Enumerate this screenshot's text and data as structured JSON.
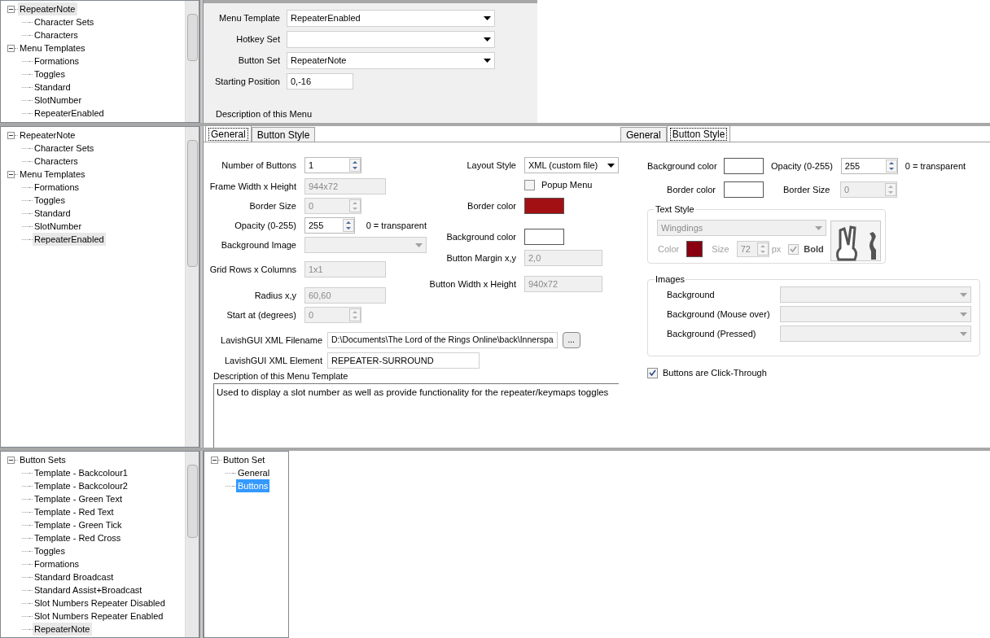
{
  "top_tree": {
    "focused": false,
    "nodes": [
      {
        "label": "RepeaterNote",
        "selected": true,
        "expanded": true,
        "children": [
          {
            "label": "Character Sets",
            "selected": false
          },
          {
            "label": "Characters",
            "selected": false
          }
        ]
      },
      {
        "label": "Menu Templates",
        "selected": false,
        "expanded": true,
        "children": [
          {
            "label": "Formations",
            "selected": false
          },
          {
            "label": "Toggles",
            "selected": false
          },
          {
            "label": "Standard",
            "selected": false
          },
          {
            "label": "SlotNumber",
            "selected": false
          },
          {
            "label": "RepeaterEnabled",
            "selected": false
          }
        ]
      }
    ]
  },
  "menu_form": {
    "fields": [
      {
        "label": "Menu Template",
        "value": "RepeaterEnabled",
        "kind": "dropdown"
      },
      {
        "label": "Hotkey Set",
        "kind": "dropdown"
      },
      {
        "label": "Button Set",
        "value": "RepeaterNote",
        "kind": "dropdown"
      },
      {
        "label": "Starting Position",
        "value": "0,-16",
        "kind": "text"
      }
    ],
    "description_label": "Description of this Menu"
  },
  "template_tree": {
    "focused": false,
    "nodes": [
      {
        "label": "RepeaterNote",
        "selected": false,
        "expanded": true,
        "children": [
          {
            "label": "Character Sets",
            "selected": false
          },
          {
            "label": "Characters",
            "selected": false
          }
        ]
      },
      {
        "label": "Menu Templates",
        "selected": false,
        "expanded": true,
        "children": [
          {
            "label": "Formations",
            "selected": false
          },
          {
            "label": "Toggles",
            "selected": false
          },
          {
            "label": "Standard",
            "selected": false
          },
          {
            "label": "SlotNumber",
            "selected": false
          },
          {
            "label": "RepeaterEnabled",
            "selected": true
          }
        ]
      }
    ]
  },
  "general_panel": {
    "tabs": [
      {
        "label": "General",
        "selected": true
      },
      {
        "label": "Button Style",
        "selected": false
      }
    ],
    "left_fields": [
      {
        "label": "Number of Buttons",
        "value": "1",
        "kind": "spin",
        "disabled": false
      },
      {
        "label": "Frame Width x Height",
        "value": "944x72",
        "kind": "text",
        "disabled": true
      },
      {
        "label": "Border Size",
        "value": "0",
        "kind": "spin",
        "disabled": true
      },
      {
        "label": "Opacity (0-255)",
        "value": "255",
        "kind": "spin",
        "disabled": false,
        "note": "0 = transparent"
      },
      {
        "label": "Background Image",
        "kind": "dropdown",
        "disabled": true
      },
      {
        "label": "Grid Rows x Columns",
        "value": "1x1",
        "kind": "text",
        "disabled": true
      },
      {
        "label": "Radius x,y",
        "value": "60,60",
        "kind": "text",
        "disabled": true
      },
      {
        "label": "Start at (degrees)",
        "value": "0",
        "kind": "spin",
        "disabled": true
      }
    ],
    "right_fields": [
      {
        "label": "Layout Style",
        "value": "XML (custom file)",
        "kind": "dropdown",
        "disabled": false
      },
      {
        "label": "Popup Menu",
        "kind": "checkbox",
        "checked": false
      },
      {
        "label": "Border color",
        "kind": "color",
        "color": "#a31014"
      },
      {
        "label": "Background color",
        "kind": "color",
        "color": "#ffffff"
      },
      {
        "label": "Button Margin x,y",
        "value": "2,0",
        "kind": "text",
        "disabled": true
      },
      {
        "label": "Button Width x Height",
        "value": "940x72",
        "kind": "text",
        "disabled": true
      }
    ],
    "xml_filename": {
      "label": "LavishGUI XML Filename",
      "value": "D:\\Documents\\The Lord of the Rings Online\\back\\Innerspa",
      "button": "..."
    },
    "xml_element": {
      "label": "LavishGUI XML Element",
      "value": "REPEATER-SURROUND"
    },
    "description": {
      "label": "Description of this Menu Template",
      "value": "Used to display a slot number as well as provide functionality for the repeater/keymaps toggles"
    }
  },
  "style_panel": {
    "tabs": [
      {
        "label": "General",
        "selected": false
      },
      {
        "label": "Button Style",
        "selected": true
      }
    ],
    "background_color": {
      "label": "Background color",
      "color": "#ffffff"
    },
    "opacity": {
      "label": "Opacity (0-255)",
      "value": "255",
      "note": "0 = transparent"
    },
    "border_color": {
      "label": "Border color",
      "color": "#ffffff"
    },
    "border_size": {
      "label": "Border Size",
      "value": "0"
    },
    "text_style": {
      "title": "Text Style",
      "font": "Wingdings",
      "color_label": "Color",
      "color": "#8b0010",
      "size_label": "Size",
      "size": "72",
      "unit": "px",
      "bold_label": "Bold",
      "bold": true
    },
    "images": {
      "title": "Images",
      "rows": [
        {
          "label": "Background"
        },
        {
          "label": "Background (Mouse over)"
        },
        {
          "label": "Background (Pressed)"
        }
      ]
    },
    "click_through": {
      "label": "Buttons are Click-Through",
      "checked": true
    }
  },
  "sets_tree": {
    "focused": false,
    "nodes": [
      {
        "label": "Button Sets",
        "selected": false,
        "expanded": true,
        "children": [
          {
            "label": "Template - Backcolour1",
            "selected": false
          },
          {
            "label": "Template - Backcolour2",
            "selected": false
          },
          {
            "label": "Template - Green Text",
            "selected": false
          },
          {
            "label": "Template - Red Text",
            "selected": false
          },
          {
            "label": "Template - Green Tick",
            "selected": false
          },
          {
            "label": "Template - Red Cross",
            "selected": false
          },
          {
            "label": "Toggles",
            "selected": false
          },
          {
            "label": "Formations",
            "selected": false
          },
          {
            "label": "Standard Broadcast",
            "selected": false
          },
          {
            "label": "Standard Assist+Broadcast",
            "selected": false
          },
          {
            "label": "Slot Numbers Repeater Disabled",
            "selected": false
          },
          {
            "label": "Slot Numbers Repeater Enabled",
            "selected": false
          },
          {
            "label": "RepeaterNote",
            "selected": true
          }
        ]
      }
    ]
  },
  "set_tree": {
    "focused": true,
    "nodes": [
      {
        "label": "Button Set",
        "selected": false,
        "expanded": true,
        "children": [
          {
            "label": "General",
            "selected": false
          },
          {
            "label": "Buttons",
            "selected": true
          }
        ]
      }
    ]
  }
}
